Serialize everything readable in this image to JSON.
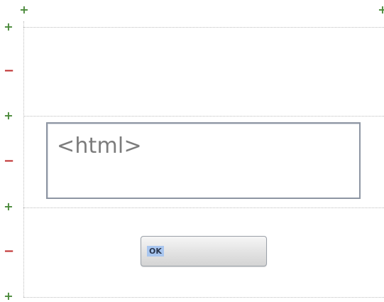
{
  "row_markers": {
    "add_symbol": "+",
    "remove_symbol": "−",
    "add_color": "#4a8a3a",
    "remove_color": "#c03030"
  },
  "html_box": {
    "text": "<html>"
  },
  "ok_button": {
    "label": "OK"
  }
}
